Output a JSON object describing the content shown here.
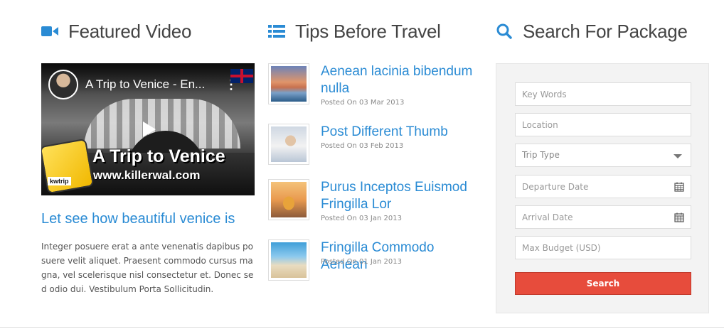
{
  "featured_video": {
    "heading": "Featured Video",
    "video": {
      "title": "A Trip to Venice - En...",
      "overlay_title": "A Trip to Venice",
      "overlay_url": "www.killerwal.com",
      "logo_text": "kwtrip"
    },
    "caption_heading": "Let see how beautiful venice is",
    "description": "Integer posuere erat a ante venenatis dapibus posuere velit aliquet. Praesent commodo cursus magna, vel scelerisque nisl consectetur et. Donec sed odio dui. Vestibulum Porta Sollicitudin."
  },
  "tips": {
    "heading": "Tips Before Travel",
    "items": [
      {
        "title": "Aenean lacinia bibendum nulla",
        "date": "Posted On 03 Mar 2013",
        "thumb": "sunset-coast"
      },
      {
        "title": "Post Different Thumb",
        "date": "Posted On 03 Feb 2013",
        "thumb": "sleeping-man"
      },
      {
        "title": "Purus Inceptos Euismod Fringilla Lor",
        "date": "Posted On 03 Jan 2013",
        "thumb": "bus-sunset"
      },
      {
        "title": "Fringilla Commodo Aenean",
        "date": "Posted On 01 Jan 2013",
        "thumb": "beach-chairs"
      }
    ]
  },
  "search": {
    "heading": "Search For Package",
    "fields": {
      "keywords": "Key Words",
      "location": "Location",
      "trip_type": "Trip Type",
      "departure_date": "Departure Date",
      "arrival_date": "Arrival Date",
      "max_budget": "Max Budget (USD)"
    },
    "button_label": "Search"
  },
  "colors": {
    "accent": "#2a8bd4",
    "button": "#e74c3c",
    "heading_text": "#444444"
  }
}
